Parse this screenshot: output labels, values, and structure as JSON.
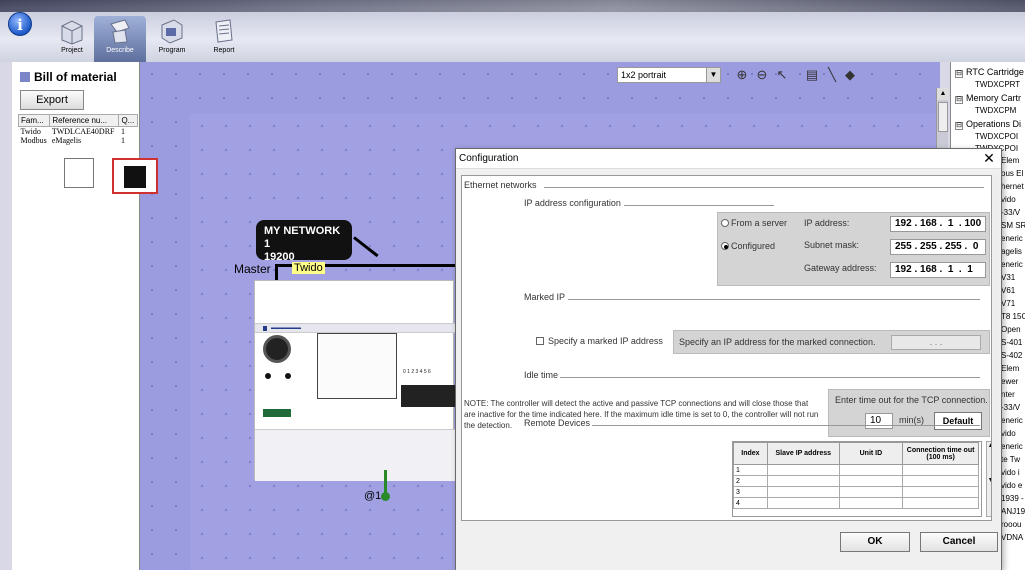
{
  "toolbar": {
    "tabs": [
      {
        "label": "Project",
        "icon": "project-icon"
      },
      {
        "label": "Describe",
        "icon": "describe-icon",
        "active": true
      },
      {
        "label": "Program",
        "icon": "program-icon"
      },
      {
        "label": "Report",
        "icon": "report-icon"
      }
    ],
    "info_icon": "i"
  },
  "bom": {
    "title": "Bill of material",
    "export_label": "Export",
    "columns": [
      "Fam...",
      "Reference nu...",
      "Q..."
    ],
    "rows": [
      [
        "Twido",
        "TWDLCAE40DRF",
        "1"
      ],
      [
        "Modbus",
        "eMagelis",
        "1"
      ]
    ]
  },
  "canvas": {
    "view_select": "1x2 portrait",
    "network_name": "MY NETWORK 1",
    "network_speed": "19200",
    "master_label": "Master",
    "device_label": "Twido",
    "address_label": "@1",
    "io_numbers": "0 1 2 3 4 5 6"
  },
  "tree": {
    "nodes": [
      {
        "label": "RTC Cartridge",
        "box": "⊟"
      },
      {
        "label": "TWDXCPRT",
        "leaf": true
      },
      {
        "label": "Memory Cartr",
        "box": "⊟"
      },
      {
        "label": "TWDXCPM",
        "leaf": true
      },
      {
        "label": "Operations Di",
        "box": "⊟"
      },
      {
        "label": "TWDXCPOI",
        "leaf": true
      },
      {
        "label": "TWDXCPOI",
        "leaf": true
      }
    ],
    "fragments": [
      "Elem",
      "ous El",
      "hernet",
      "vido",
      "-33/V",
      "SM SR",
      "eneric",
      "agelis",
      "eneric",
      "V31",
      "V61",
      "V71",
      "T8 15C",
      "Open",
      "S-401",
      "S-402",
      "Elem",
      "ewer",
      "nter",
      "-33/V",
      "eneric",
      "vido",
      "eneric",
      "te Tw",
      "vido i",
      "vido e",
      "1939 -",
      "ANJ19",
      "rooou",
      "VDNA"
    ]
  },
  "dialog": {
    "title": "Configuration",
    "close": "✕",
    "ethernet_section": "Ethernet networks",
    "ip_section": "IP address configuration",
    "from_server": "From a server",
    "configured": "Configured",
    "ip_label": "IP address:",
    "ip_value": "192 . 168 .  1  . 100",
    "subnet_label": "Subnet mask:",
    "subnet_value": "255 . 255 . 255 .  0",
    "gateway_label": "Gateway address:",
    "gateway_value": "192 . 168 .  1  .  1",
    "marked_section": "Marked IP",
    "marked_check": "Specify a marked IP address",
    "marked_hint": "Specify an IP address for the marked connection.",
    "marked_value": ".        .        .",
    "idle_section": "Idle time",
    "note": "NOTE: The controller will detect the active and passive TCP connections and will close those that are inactive for the time indicated here.  If the maximum idle time is set to 0, the controller will not run the detection.",
    "idle_prompt": "Enter time out for the TCP connection.",
    "idle_value": "10",
    "idle_unit": "min(s)",
    "default_label": "Default",
    "remote_section": "Remote Devices",
    "remote_columns": [
      "Index",
      "Slave IP address",
      "Unit ID",
      "Connection time out   (100 ms)"
    ],
    "remote_rows": [
      "1",
      "2",
      "3",
      "4"
    ],
    "ok_label": "OK",
    "cancel_label": "Cancel"
  }
}
